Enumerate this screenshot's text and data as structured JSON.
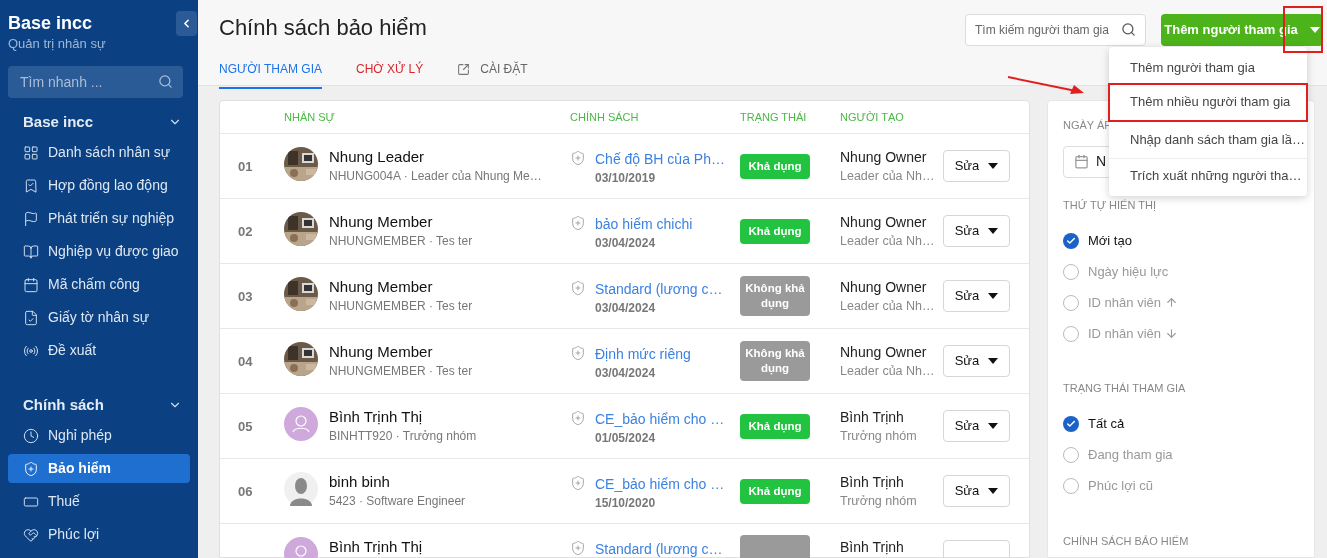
{
  "sidebar": {
    "title": "Base incc",
    "subtitle": "Quản trị nhân sự",
    "search": {
      "placeholder": "Tìm nhanh ..."
    },
    "groups": [
      {
        "title": "Base incc",
        "expanded": true,
        "items": [
          {
            "label": "Danh sách nhân sự",
            "selected": false
          },
          {
            "label": "Hợp đồng lao động",
            "selected": false
          },
          {
            "label": "Phát triển sự nghiệp",
            "selected": false
          },
          {
            "label": "Nghiệp vụ được giao",
            "selected": false
          },
          {
            "label": "Mã chấm công",
            "selected": false
          },
          {
            "label": "Giấy tờ nhân sự",
            "selected": false
          },
          {
            "label": "Đề xuất",
            "selected": false
          }
        ]
      },
      {
        "title": "Chính sách",
        "expanded": true,
        "items": [
          {
            "label": "Nghỉ phép",
            "selected": false
          },
          {
            "label": "Bảo hiểm",
            "selected": true
          },
          {
            "label": "Thuế",
            "selected": false
          },
          {
            "label": "Phúc lợi",
            "selected": false
          }
        ]
      }
    ]
  },
  "header": {
    "title": "Chính sách bảo hiểm",
    "search": {
      "placeholder": "Tìm kiếm người tham gia"
    },
    "add_button": "Thêm người tham gia",
    "tabs": [
      {
        "label": "NGƯỜI THAM GIA",
        "selected": true,
        "kind": "normal"
      },
      {
        "label": "CHỜ XỬ LÝ",
        "selected": false,
        "kind": "alert"
      },
      {
        "label": "CÀI ĐẶT",
        "selected": false,
        "kind": "link"
      }
    ]
  },
  "table": {
    "columns": [
      "NHÂN SỰ",
      "CHÍNH SÁCH",
      "TRẠNG THÁI",
      "NGƯỜI TẠO"
    ],
    "rows": [
      {
        "number": "01",
        "name": "Nhung Leader",
        "sub": "NHUNG004A · Leader của Nhung Me…",
        "policy": "Chế độ BH của Ph…",
        "date": "03/10/2019",
        "status": {
          "label": "Khả dụng",
          "kind": "available"
        },
        "creator": "Nhung Owner",
        "creator_sub": "Leader của Nh…",
        "action": "Sửa"
      },
      {
        "number": "02",
        "name": "Nhung Member",
        "sub": "NHUNGMEMBER · Tes ter",
        "policy": "bảo hiểm chichi",
        "date": "03/04/2024",
        "status": {
          "label": "Khả dụng",
          "kind": "available"
        },
        "creator": "Nhung Owner",
        "creator_sub": "Leader của Nh…",
        "action": "Sửa"
      },
      {
        "number": "03",
        "name": "Nhung Member",
        "sub": "NHUNGMEMBER · Tes ter",
        "policy": "Standard (lương c…",
        "date": "03/04/2024",
        "status": {
          "label": "Không khả dụng",
          "kind": "unavailable"
        },
        "creator": "Nhung Owner",
        "creator_sub": "Leader của Nh…",
        "action": "Sửa"
      },
      {
        "number": "04",
        "name": "Nhung Member",
        "sub": "NHUNGMEMBER · Tes ter",
        "policy": "Định mức riêng",
        "date": "03/04/2024",
        "status": {
          "label": "Không khả dụng",
          "kind": "unavailable"
        },
        "creator": "Nhung Owner",
        "creator_sub": "Leader của Nh…",
        "action": "Sửa"
      },
      {
        "number": "05",
        "avatar": {
          "kind": "placeholder"
        },
        "name": "Bình Trịnh Thị",
        "sub": "BINHTT920 · Trưởng nhóm",
        "policy": "CE_bảo hiểm cho …",
        "date": "01/05/2024",
        "status": {
          "label": "Khả dụng",
          "kind": "available"
        },
        "creator": "Bình Trịnh",
        "creator_sub": "Trưởng nhóm",
        "action": "Sửa"
      },
      {
        "number": "06",
        "avatar": {
          "kind": "silhouette"
        },
        "name": "binh binh",
        "sub": "5423 · Software Engineer",
        "policy": "CE_bảo hiểm cho …",
        "date": "15/10/2020",
        "status": {
          "label": "Khả dụng",
          "kind": "available"
        },
        "creator": "Bình Trịnh",
        "creator_sub": "Trưởng nhóm",
        "action": "Sửa"
      },
      {
        "avatar": {
          "kind": "placeholder"
        },
        "name": "Bình Trịnh Thị",
        "policy": "Standard (lương c…",
        "status": {
          "kind": "unavailable"
        },
        "creator": "Bình Trịnh"
      }
    ]
  },
  "filters": {
    "date_label": "NGÀY ÁP",
    "date_value": "N",
    "groups": [
      {
        "title": "THỨ TỰ HIỂN THỊ",
        "options": [
          {
            "label": "Mới tạo",
            "selected": true,
            "kind": "plain"
          },
          {
            "label": "Ngày hiệu lực",
            "selected": false,
            "kind": "plain"
          },
          {
            "label": "ID nhân viên",
            "selected": false,
            "kind": "sort_up"
          },
          {
            "label": "ID nhân viên",
            "selected": false,
            "kind": "sort_down"
          }
        ]
      },
      {
        "title": "TRẠNG THÁI THAM GIA",
        "options": [
          {
            "label": "Tất cả",
            "selected": true
          },
          {
            "label": "Đang tham gia",
            "selected": false
          },
          {
            "label": "Phúc lợi cũ",
            "selected": false
          }
        ]
      },
      {
        "title": "CHÍNH SÁCH BẢO HIỂM"
      }
    ]
  },
  "menu": {
    "items": [
      {
        "label": "Thêm người tham gia",
        "highlighted": false
      },
      {
        "label": "Thêm nhiều người tham gia",
        "highlighted": true
      },
      {
        "label": "Nhập danh sách tham gia lầ…",
        "highlighted": false
      },
      {
        "label": "Trích xuất những người tha…",
        "highlighted": false
      }
    ]
  }
}
